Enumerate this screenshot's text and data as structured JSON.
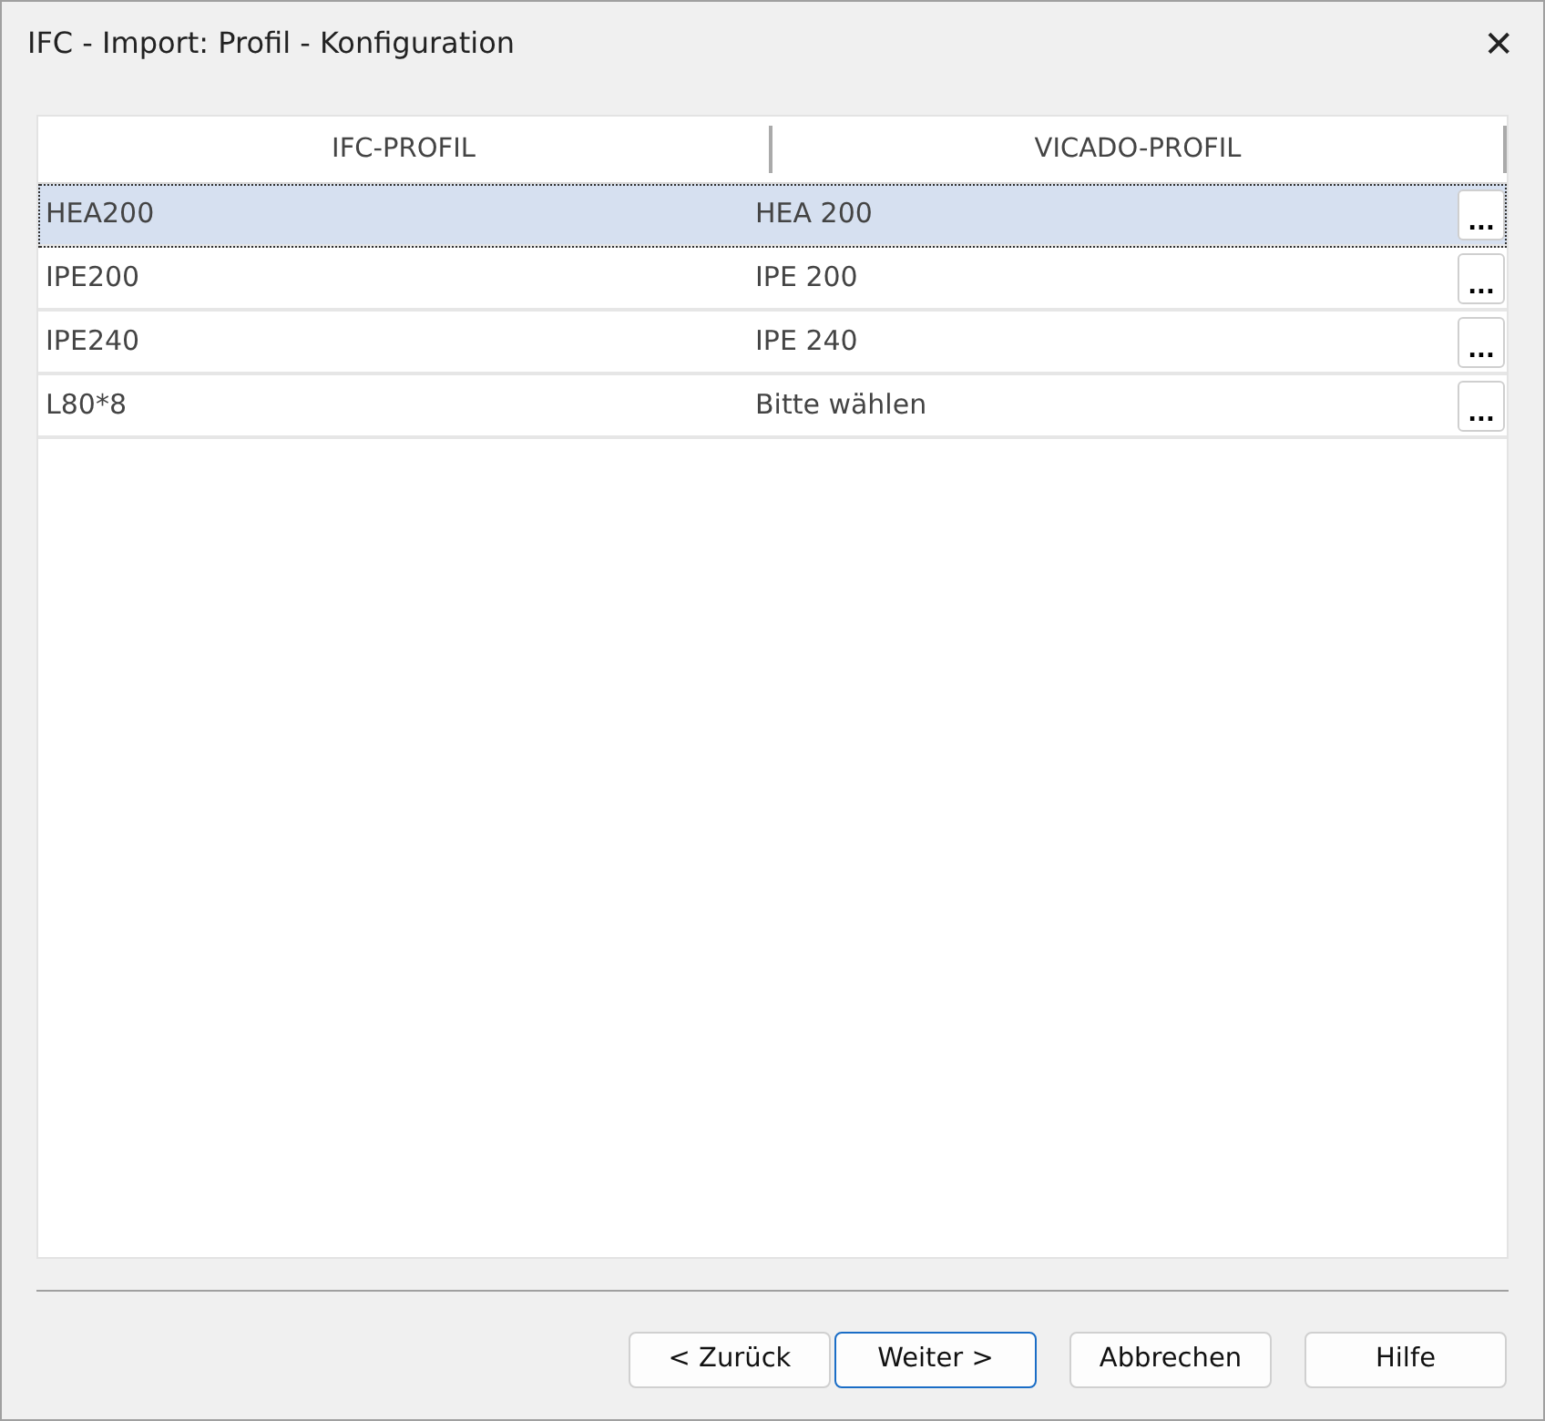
{
  "window": {
    "title": "IFC - Import: Profil - Konfiguration",
    "close": "✕"
  },
  "table": {
    "columns": [
      "IFC-PROFIL",
      "VICADO-PROFIL"
    ],
    "rows": [
      {
        "ifc": "HEA200",
        "vicado": "HEA 200",
        "button": "...",
        "selected": true
      },
      {
        "ifc": "IPE200",
        "vicado": "IPE 200",
        "button": "...",
        "selected": false
      },
      {
        "ifc": "IPE240",
        "vicado": "IPE 240",
        "button": "...",
        "selected": false
      },
      {
        "ifc": "L80*8",
        "vicado": "Bitte wählen",
        "button": "...",
        "selected": false
      }
    ]
  },
  "buttons": [
    {
      "label": "< Zurück",
      "default": false
    },
    {
      "label": "Weiter >",
      "default": true
    },
    {
      "label": "Abbrechen",
      "default": false
    },
    {
      "label": "Hilfe",
      "default": false
    }
  ]
}
